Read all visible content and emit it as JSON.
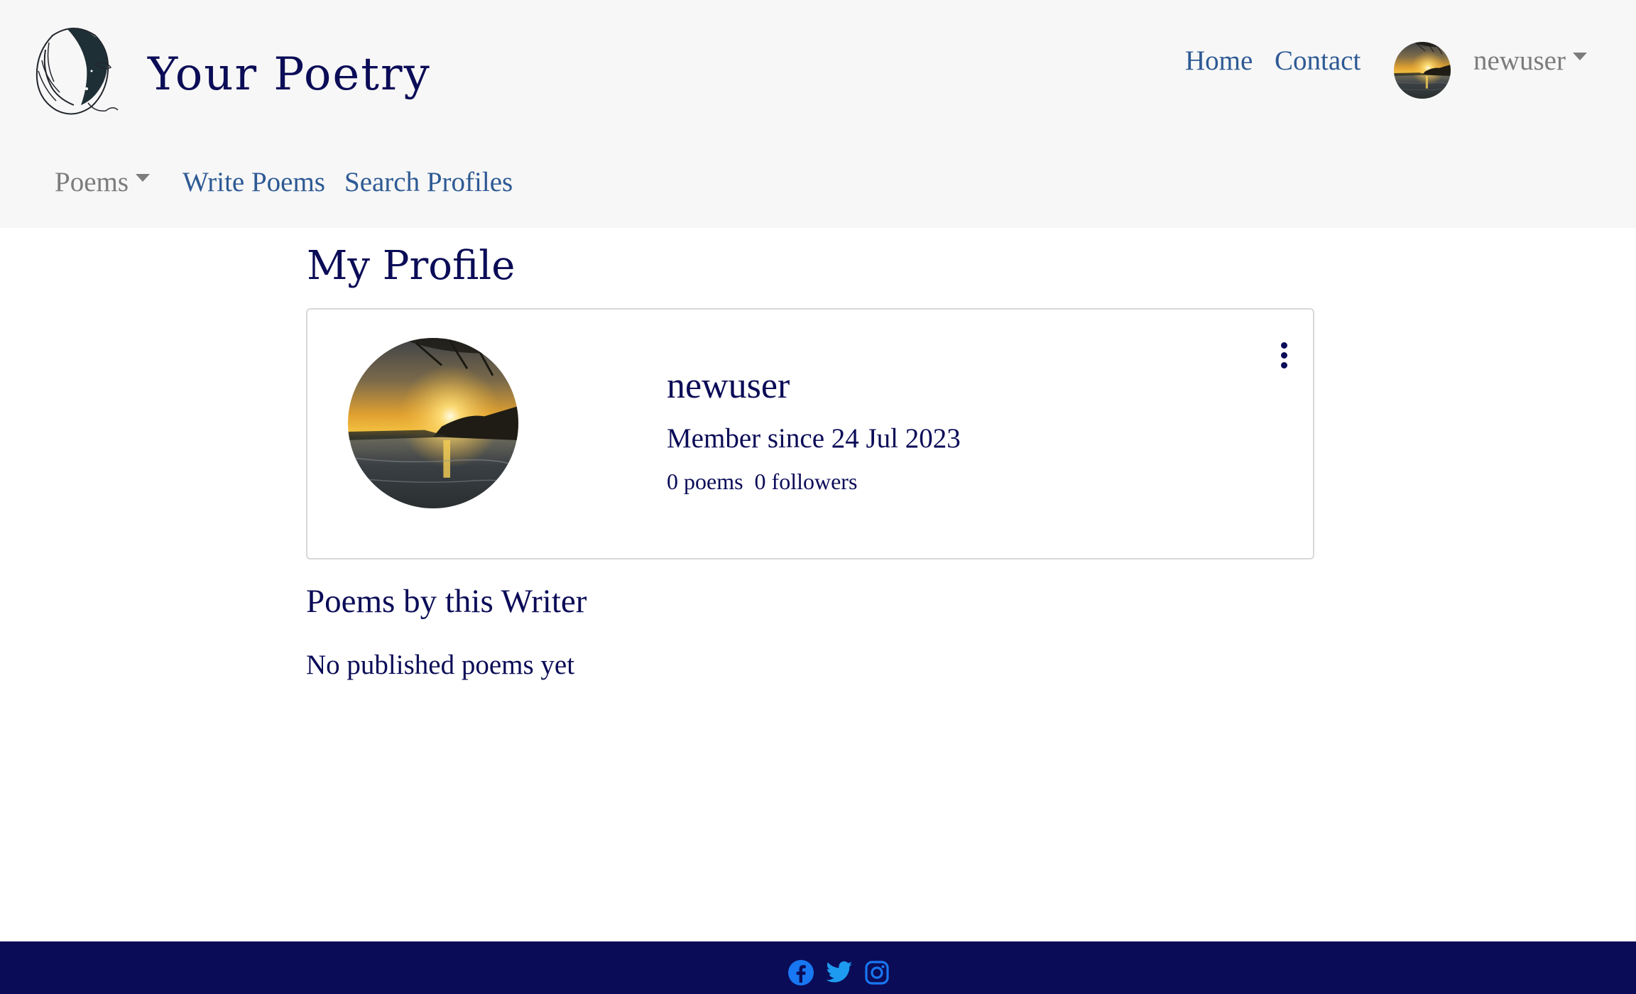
{
  "brand": {
    "title": "Your Poetry",
    "logo_icon": "poet-face-logo"
  },
  "top_nav": {
    "home": "Home",
    "contact": "Contact",
    "username": "newuser"
  },
  "sub_nav": {
    "poems": "Poems",
    "write_poems": "Write Poems",
    "search_profiles": "Search Profiles"
  },
  "page": {
    "title": "My Profile"
  },
  "profile": {
    "username": "newuser",
    "member_since": "Member since 24 Jul 2023",
    "poems_count": "0 poems",
    "followers_count": "0 followers"
  },
  "poems_section": {
    "title": "Poems by this Writer",
    "empty_message": "No published poems yet"
  },
  "footer": {
    "icons": [
      "facebook-icon",
      "twitter-icon",
      "instagram-icon"
    ]
  },
  "colors": {
    "navy": "#0b0c57",
    "link_blue": "#2d5a94",
    "muted_gray": "#7c7c7c",
    "header_bg": "#f7f7f7",
    "social_blue": "#1877f2"
  }
}
